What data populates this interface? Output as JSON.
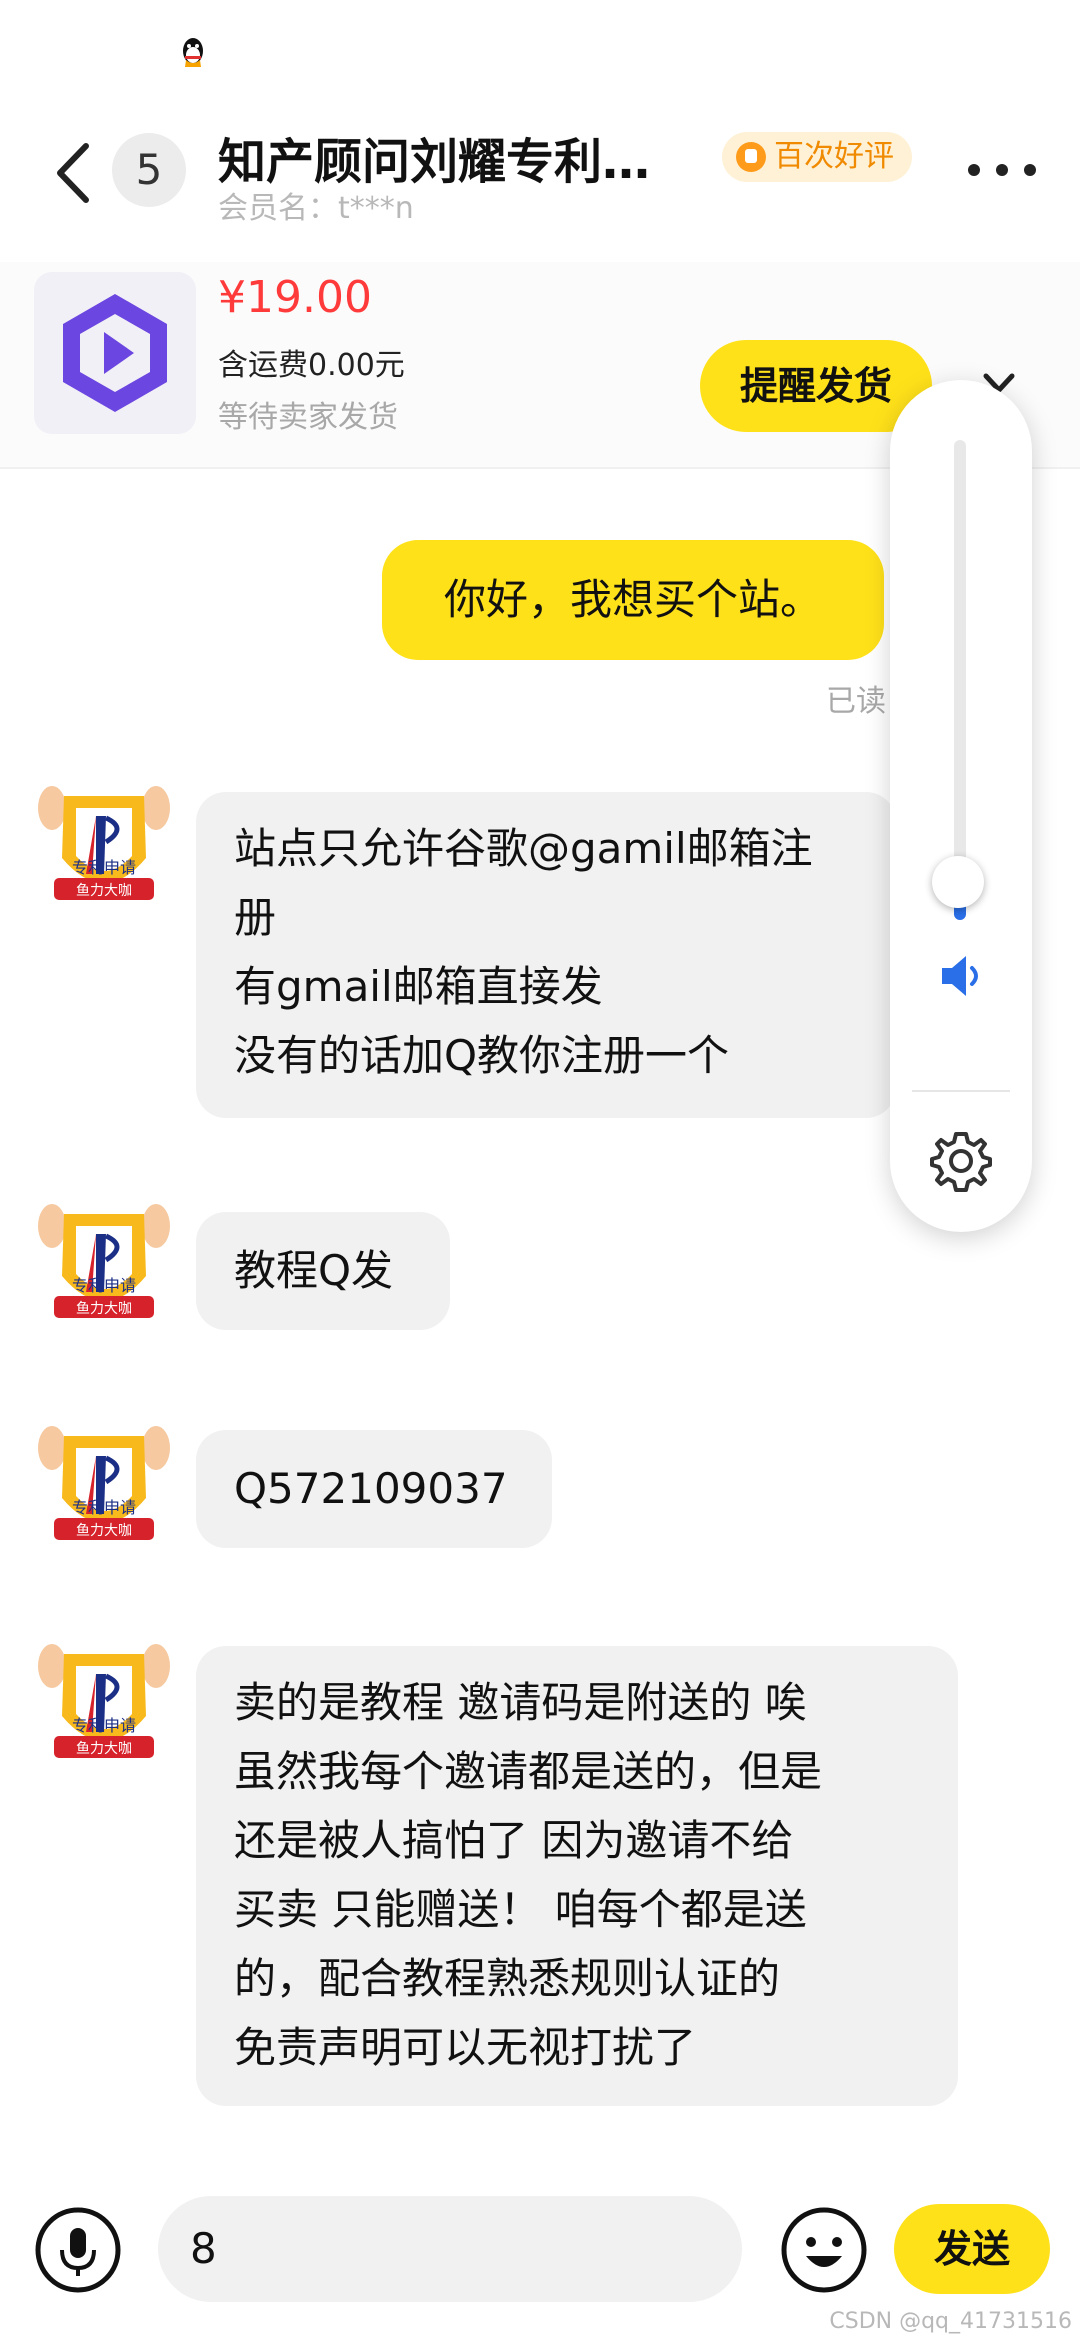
{
  "header": {
    "unread_count": "5",
    "title": "知产顾问刘耀专利…",
    "member_label": "会员名：t***n",
    "badge": "百次好评"
  },
  "order": {
    "price": "¥19.00",
    "shipping": "含运费0.00元",
    "status": "等待卖家发货",
    "remind_button": "提醒发货"
  },
  "messages": [
    {
      "side": "out",
      "text": "你好，我想买个站。",
      "status": "已读"
    },
    {
      "side": "in",
      "lines": [
        "站点只允许谷歌@gamil邮箱注",
        "册",
        "有gmail邮箱直接发",
        "没有的话加Q教你注册一个"
      ]
    },
    {
      "side": "in",
      "text": "教程Q发"
    },
    {
      "side": "in",
      "text": "Q572109037"
    },
    {
      "side": "in",
      "lines": [
        "卖的是教程  邀请码是附送的  唉",
        "虽然我每个邀请都是送的，但是",
        "还是被人搞怕了  因为邀请不给",
        "买卖 只能赠送！  咱每个都是送",
        "的，配合教程熟悉规则认证的",
        "免责声明可以无视打扰了"
      ]
    }
  ],
  "avatar": {
    "label_top": "专利申请",
    "label_bottom": "鱼力大咖"
  },
  "volume": {
    "level": 0.08
  },
  "input": {
    "value": "8",
    "send_label": "发送"
  },
  "watermark": "CSDN @qq_41731516",
  "colors": {
    "accent": "#ffe11a",
    "price": "#ff3a3a",
    "badge_text": "#f08a00",
    "volume": "#2a6fe8"
  }
}
